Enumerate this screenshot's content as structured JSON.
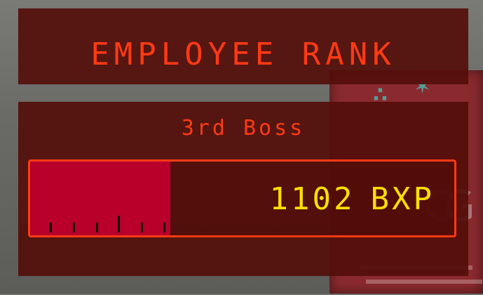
{
  "hud": {
    "title": "EMPLOYEE RANK",
    "rank_name": "3rd Boss",
    "progress": {
      "value": "1102",
      "unit": "BXP",
      "fill_fraction": 0.33
    }
  },
  "colors": {
    "panel_bg": "#540e0a",
    "accent_text": "#ff3a14",
    "bar_fill": "#b8002a",
    "value_text": "#ffe000"
  }
}
